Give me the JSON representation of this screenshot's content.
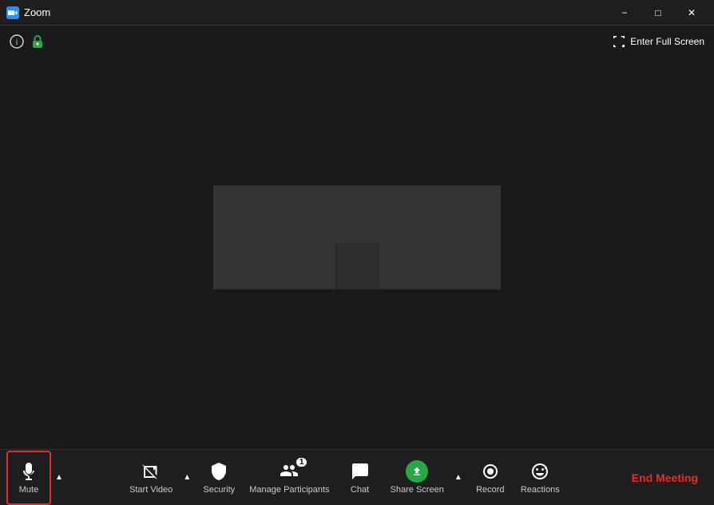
{
  "titleBar": {
    "appName": "Zoom",
    "minBtn": "−",
    "maxBtn": "□",
    "closeBtn": "✕"
  },
  "topOverlay": {
    "fullscreenLabel": "Enter Full Screen"
  },
  "toolbar": {
    "muteLabel": "Mute",
    "startVideoLabel": "Start Video",
    "securityLabel": "Security",
    "manageParticipantsLabel": "Manage Participants",
    "participantCount": "1",
    "chatLabel": "Chat",
    "shareScreenLabel": "Share Screen",
    "recordLabel": "Record",
    "reactionsLabel": "Reactions",
    "endMeetingLabel": "End Meeting"
  }
}
